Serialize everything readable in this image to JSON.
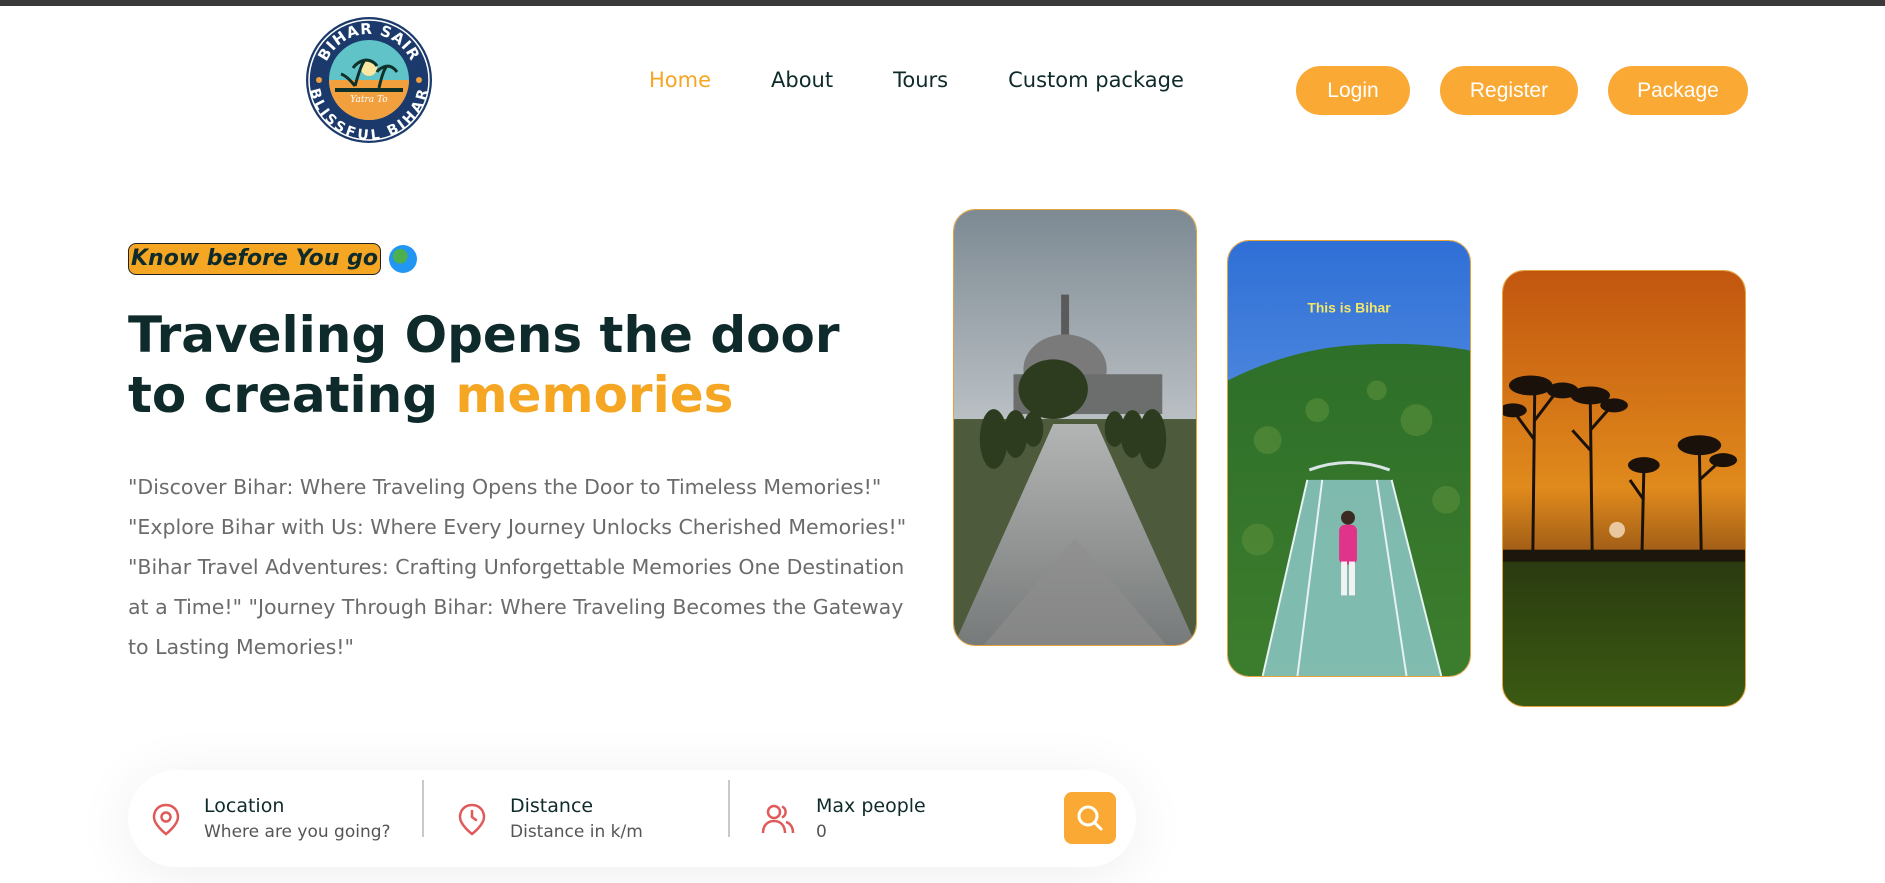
{
  "brand": {
    "logo_top_text": "BIHAR SAIR",
    "logo_bottom_text": "BLISSFUL BIHAR",
    "logo_script_text": "Yatra To"
  },
  "nav": {
    "items": [
      {
        "label": "Home",
        "active": true
      },
      {
        "label": "About",
        "active": false
      },
      {
        "label": "Tours",
        "active": false
      },
      {
        "label": "Custom package",
        "active": false
      }
    ]
  },
  "header_buttons": {
    "login": "Login",
    "register": "Register",
    "package": "Package"
  },
  "hero": {
    "tag": "Know before You go",
    "tag_icon": "globe-icon",
    "headline_part1": "Traveling Opens the door to creating ",
    "headline_highlight": "memories",
    "description": "\"Discover Bihar: Where Traveling Opens the Door to Timeless Memories!\" \"Explore Bihar with Us: Where Every Journey Unlocks Cherished Memories!\" \"Bihar Travel Adventures: Crafting Unforgettable Memories One Destination at a Time!\" \"Journey Through Bihar: Where Traveling Becomes the Gateway to Lasting Memories!\""
  },
  "gallery": {
    "photo2_caption": "This is Bihar"
  },
  "search": {
    "location": {
      "label": "Location",
      "value": "Where are you going?"
    },
    "distance": {
      "label": "Distance",
      "value": "Distance in k/m"
    },
    "max_people": {
      "label": "Max people",
      "value": "0"
    }
  },
  "colors": {
    "accent": "#faa935",
    "text_dark": "#0f2a2a",
    "icon_red": "#e05a5a"
  }
}
